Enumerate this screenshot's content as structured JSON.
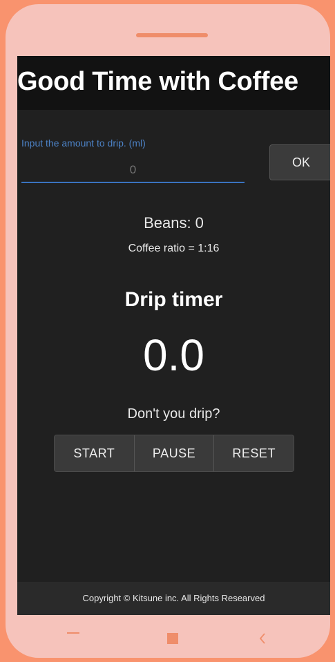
{
  "app": {
    "title": "Good Time with Coffee"
  },
  "amount": {
    "label": "Input the amount to drip. (ml)",
    "placeholder": "0",
    "value": "",
    "ok_label": "OK"
  },
  "beans_text": "Beans: 0",
  "ratio_text": "Coffee ratio = 1:16",
  "timer": {
    "heading": "Drip timer",
    "value": "0.0",
    "prompt": "Don't you drip?",
    "start_label": "START",
    "pause_label": "PAUSE",
    "reset_label": "RESET"
  },
  "footer_text": "Copyright © Kitsune inc. All Rights Researved",
  "nav": {
    "icons": [
      "menu-icon",
      "home-icon",
      "back-icon"
    ]
  },
  "colors": {
    "background": "#f9936e",
    "phone_frame": "#f6c3bb",
    "screen": "#202020",
    "accent": "#3a73c0"
  }
}
